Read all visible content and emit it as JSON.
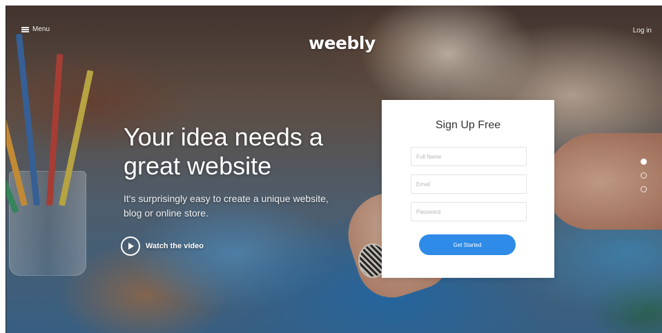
{
  "nav": {
    "menu_label": "Menu",
    "brand": "weebly",
    "login_label": "Log in"
  },
  "hero": {
    "headline": "Your idea needs a great website",
    "subtext": "It's surprisingly easy to create a unique website, blog or online store.",
    "video_label": "Watch the video"
  },
  "signup": {
    "title": "Sign Up Free",
    "fields": [
      {
        "placeholder": "Full Name",
        "value": ""
      },
      {
        "placeholder": "Email",
        "value": ""
      },
      {
        "placeholder": "Password",
        "value": ""
      }
    ],
    "submit_label": "Get Started"
  },
  "carousel": {
    "slides": 3,
    "active_index": 0
  },
  "colors": {
    "accent": "#2e8be8",
    "panel": "#ffffff"
  }
}
